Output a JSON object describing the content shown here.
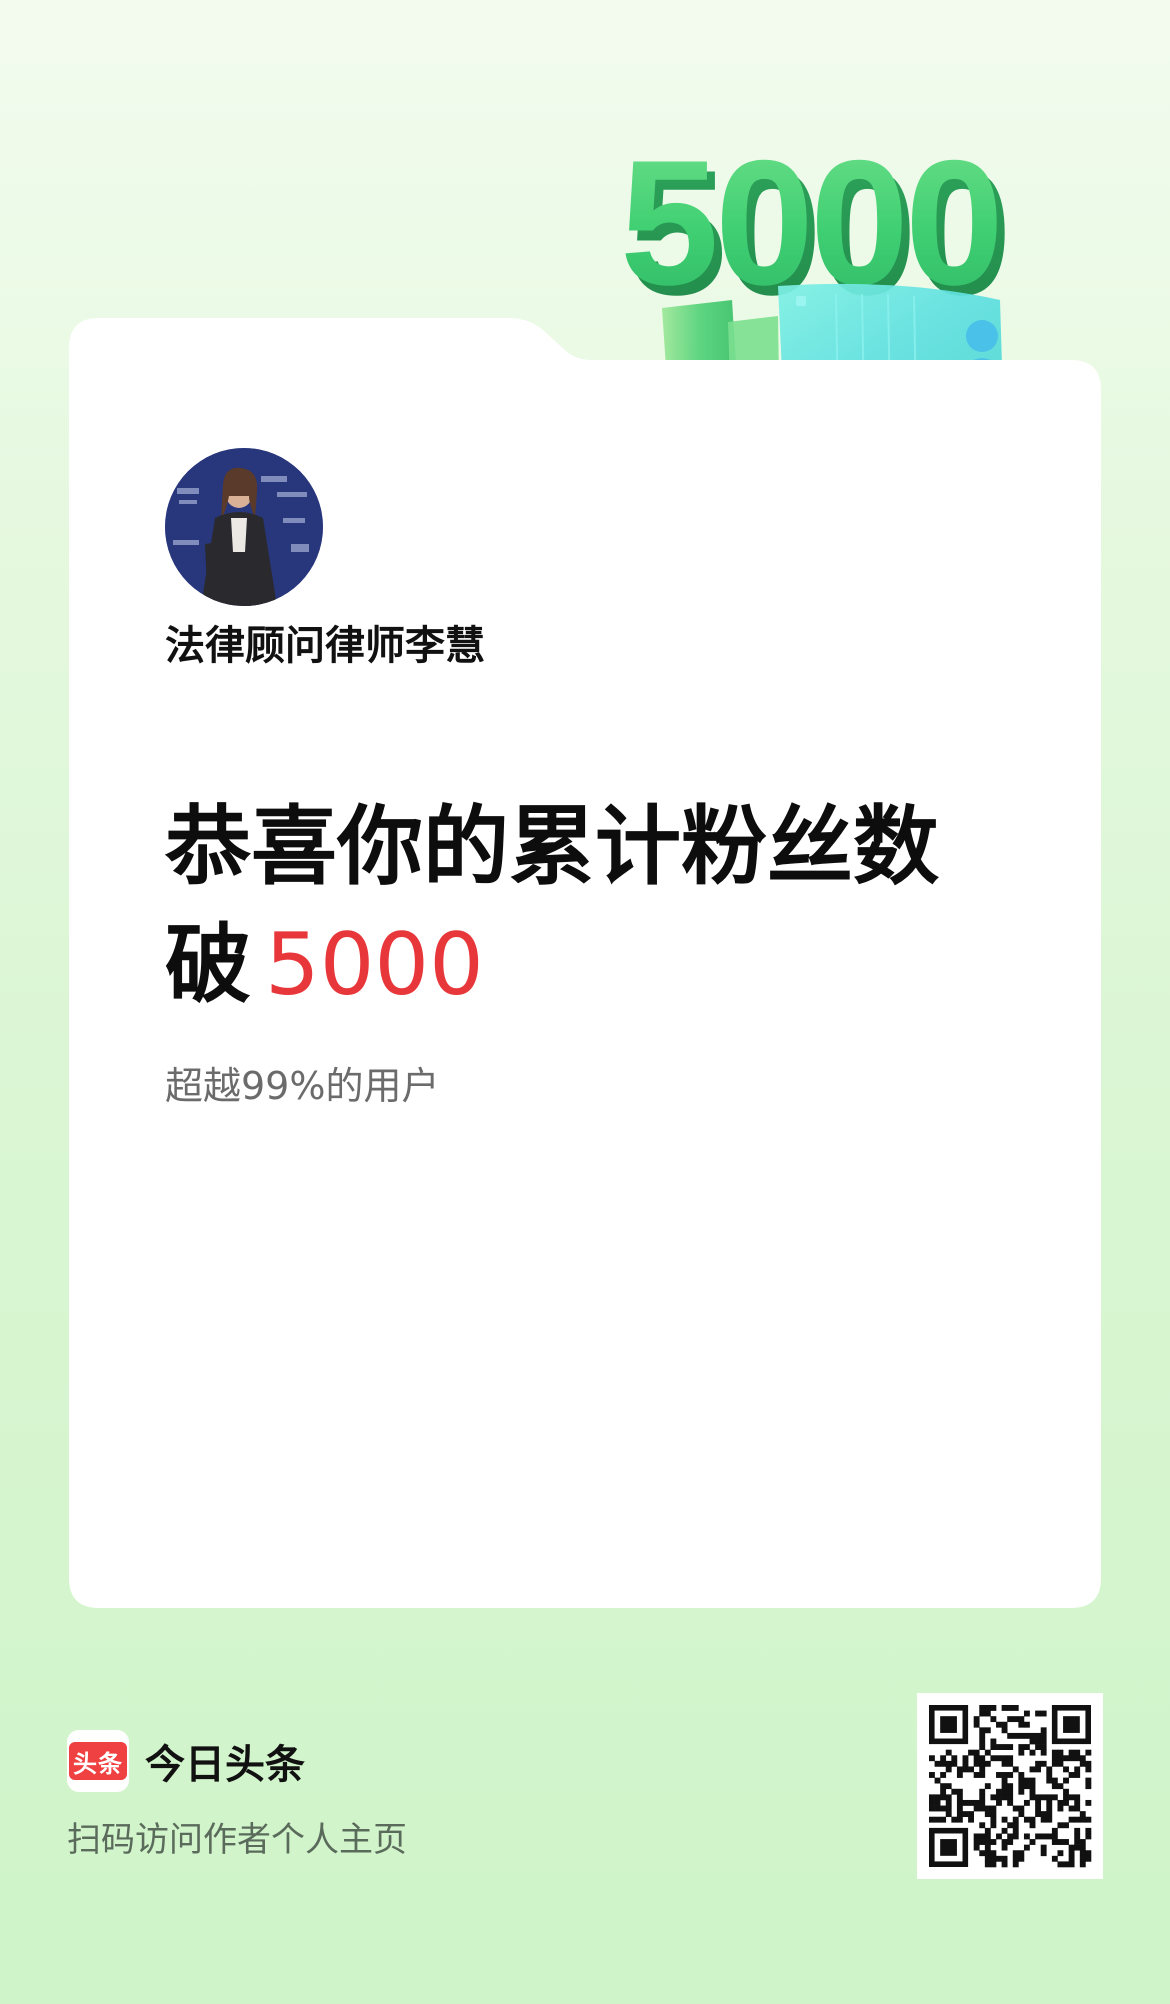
{
  "milestone": {
    "badge_number": "5000"
  },
  "author": {
    "name": "法律顾问律师李慧"
  },
  "headline": {
    "line1": "恭喜你的累计粉丝数",
    "line2_prefix": "破",
    "line2_number": "5000"
  },
  "subline": "超越99%的用户",
  "footer": {
    "brand_logo_text": "头条",
    "brand_name": "今日头条",
    "scan_text": "扫码访问作者个人主页"
  },
  "icons": {
    "avatar": "author-avatar",
    "person": "person-icon",
    "qr": "qr-code"
  },
  "colors": {
    "accent_red": "#e8373a",
    "brand_red": "#f04142",
    "milestone_green": "#3fcf72",
    "background_green": "#daf6d3"
  }
}
